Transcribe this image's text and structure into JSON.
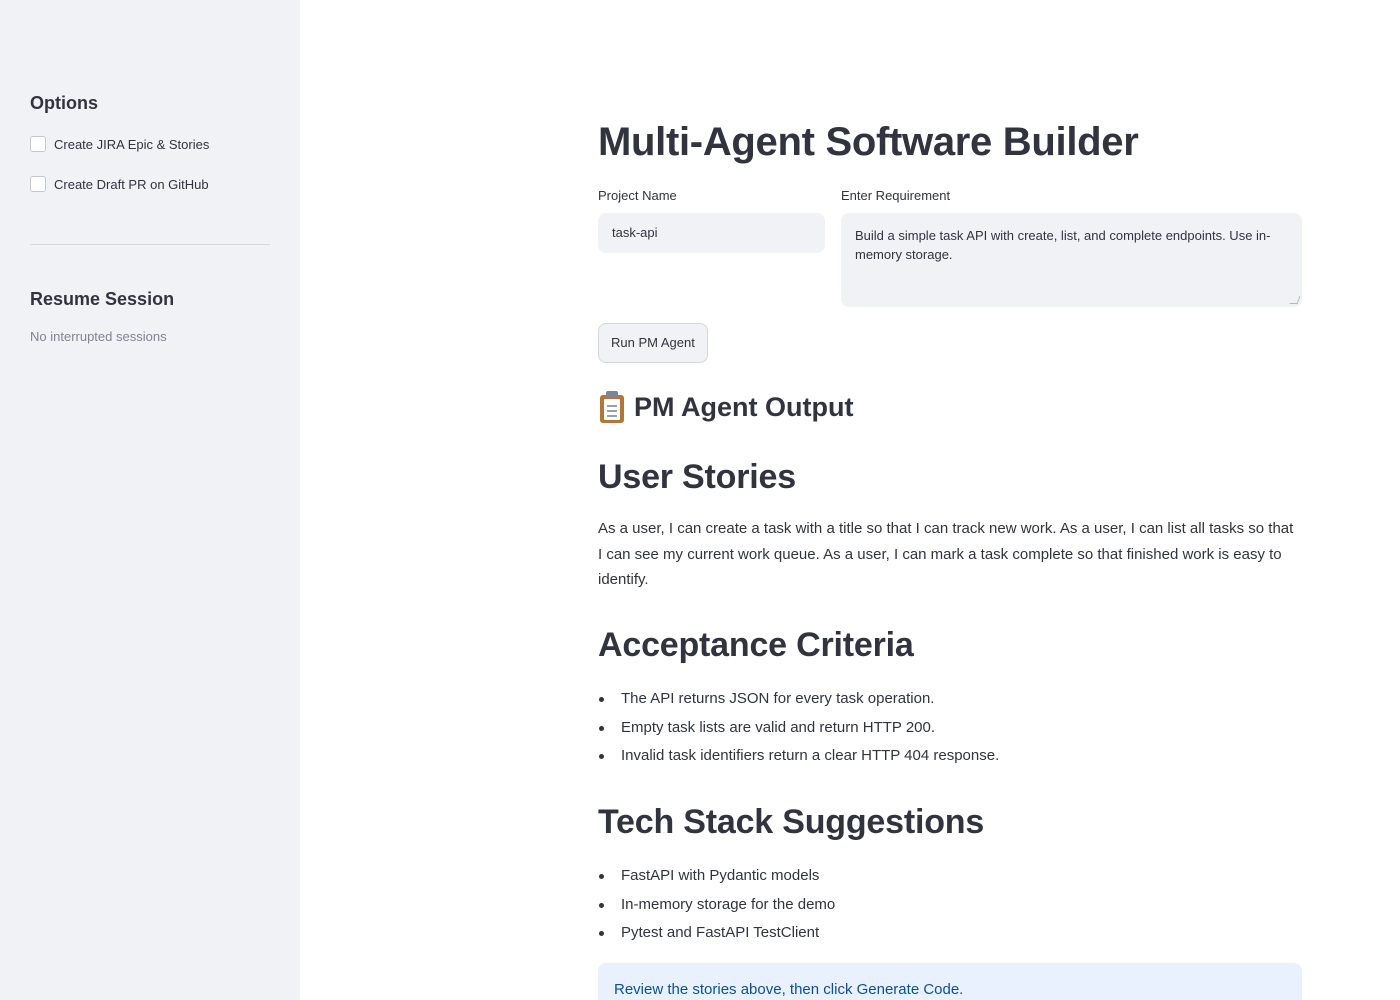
{
  "sidebar": {
    "options_heading": "Options",
    "checkboxes": [
      {
        "label": "Create JIRA Epic & Stories",
        "checked": false
      },
      {
        "label": "Create Draft PR on GitHub",
        "checked": false
      }
    ],
    "resume_heading": "Resume Session",
    "resume_status": "No interrupted sessions"
  },
  "main": {
    "title": "Multi-Agent Software Builder",
    "project_name": {
      "label": "Project Name",
      "value": "task-api"
    },
    "requirement": {
      "label": "Enter Requirement",
      "value": "Build a simple task API with create, list, and complete endpoints. Use in-memory storage."
    },
    "run_button": "Run PM Agent",
    "output_heading": "PM Agent Output",
    "output_icon": "clipboard-icon",
    "user_stories": {
      "heading": "User Stories",
      "text": "As a user, I can create a task with a title so that I can track new work. As a user, I can list all tasks so that I can see my current work queue. As a user, I can mark a task complete so that finished work is easy to identify."
    },
    "acceptance_criteria": {
      "heading": "Acceptance Criteria",
      "items": [
        "The API returns JSON for every task operation.",
        "Empty task lists are valid and return HTTP 200.",
        "Invalid task identifiers return a clear HTTP 404 response."
      ]
    },
    "tech_stack": {
      "heading": "Tech Stack Suggestions",
      "items": [
        "FastAPI with Pydantic models",
        "In-memory storage for the demo",
        "Pytest and FastAPI TestClient"
      ]
    },
    "info_message": "Review the stories above, then click Generate Code."
  },
  "colors": {
    "sidebar_bg": "#f0f2f6",
    "text": "#31333f",
    "muted": "#808495",
    "info_bg": "#e8f1fd",
    "info_text": "#0e4f94"
  }
}
